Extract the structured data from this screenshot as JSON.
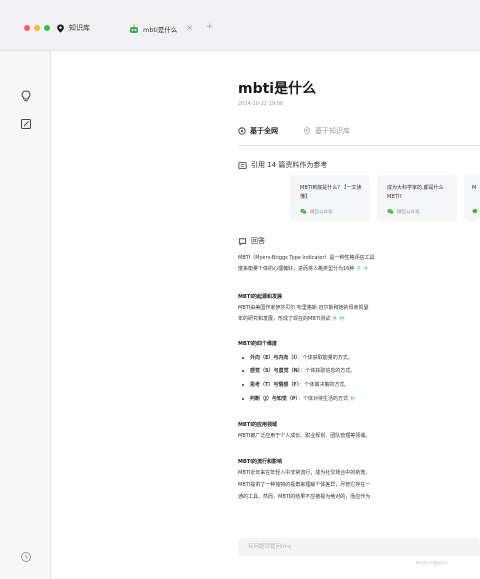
{
  "tabs": {
    "app_label": "知识库",
    "doc_label": "mbti是什么",
    "close_glyph": "×",
    "new_glyph": "+"
  },
  "document": {
    "title": "mbti是什么",
    "timestamp": "2024-10-22 19:06"
  },
  "source_tabs": {
    "web": "基于全网",
    "knowledge": "基于知识库"
  },
  "citations": {
    "heading": "引用 14 篇资料作为参考",
    "cards": [
      {
        "title": "MBTI到底是什么? 【一文读懂】",
        "source": "微信公众号"
      },
      {
        "title": "成为大科学家的,都是什么MBTI?",
        "source": "微信公众号"
      },
      {
        "title": "M",
        "source": ""
      }
    ]
  },
  "answer": {
    "heading": "回答",
    "intro_lines": [
      {
        "text": "MBTI（Myers-Briggs Type Indicator）是一种性格评估工具",
        "refs": []
      },
      {
        "text": "度来衡量个体的心理偏好，进而将人格类型分为16种",
        "refs": [
          "1",
          "4"
        ]
      }
    ],
    "sections": [
      {
        "title": "MBTI的起源和发展",
        "lines": [
          {
            "text": "MBTI由美国作家伊莎贝尔·布里格斯·迈尔斯和她的母亲凯瑟",
            "refs": []
          },
          {
            "text": "年的研究和发展，形成了现在的MBTI测试",
            "refs": [
              "8",
              "10"
            ]
          }
        ]
      },
      {
        "title": "MBTI的四个维度",
        "bullets": [
          {
            "bold": "外向（E）与内向（I）",
            "rest": "：个体获取能量的方式。",
            "refs": []
          },
          {
            "bold": "感觉（S）与直觉（N）",
            "rest": "：个体获取信息的方式。",
            "refs": []
          },
          {
            "bold": "思考（T）与情感（F）",
            "rest": "：个体做决策的方式。",
            "refs": []
          },
          {
            "bold": "判断（J）与知觉（P）",
            "rest": "：个体对待生活的方式",
            "refs": [
              "10"
            ]
          }
        ]
      },
      {
        "title": "MBTI的应用领域",
        "lines": [
          {
            "text": "MBTI被广泛应用于个人成长、职业规划、团队管理等领域。",
            "refs": []
          }
        ]
      },
      {
        "title": "MBTI的流行和影响",
        "lines": [
          {
            "text": "MBTI近年来在年轻人中非常流行，成为社交场合中的新宠。",
            "refs": []
          },
          {
            "text": "MBTI提供了一种独特的视角来理解个体差异，尽管它存在一",
            "refs": []
          },
          {
            "text": "通的工具。然而，MBTI的结果不应被视为绝对的，而应作为",
            "refs": []
          }
        ]
      }
    ]
  },
  "input": {
    "placeholder": "有问题尽管问ima"
  },
  "footer": {
    "disclaimer": "腾讯混元大模型驱动"
  }
}
